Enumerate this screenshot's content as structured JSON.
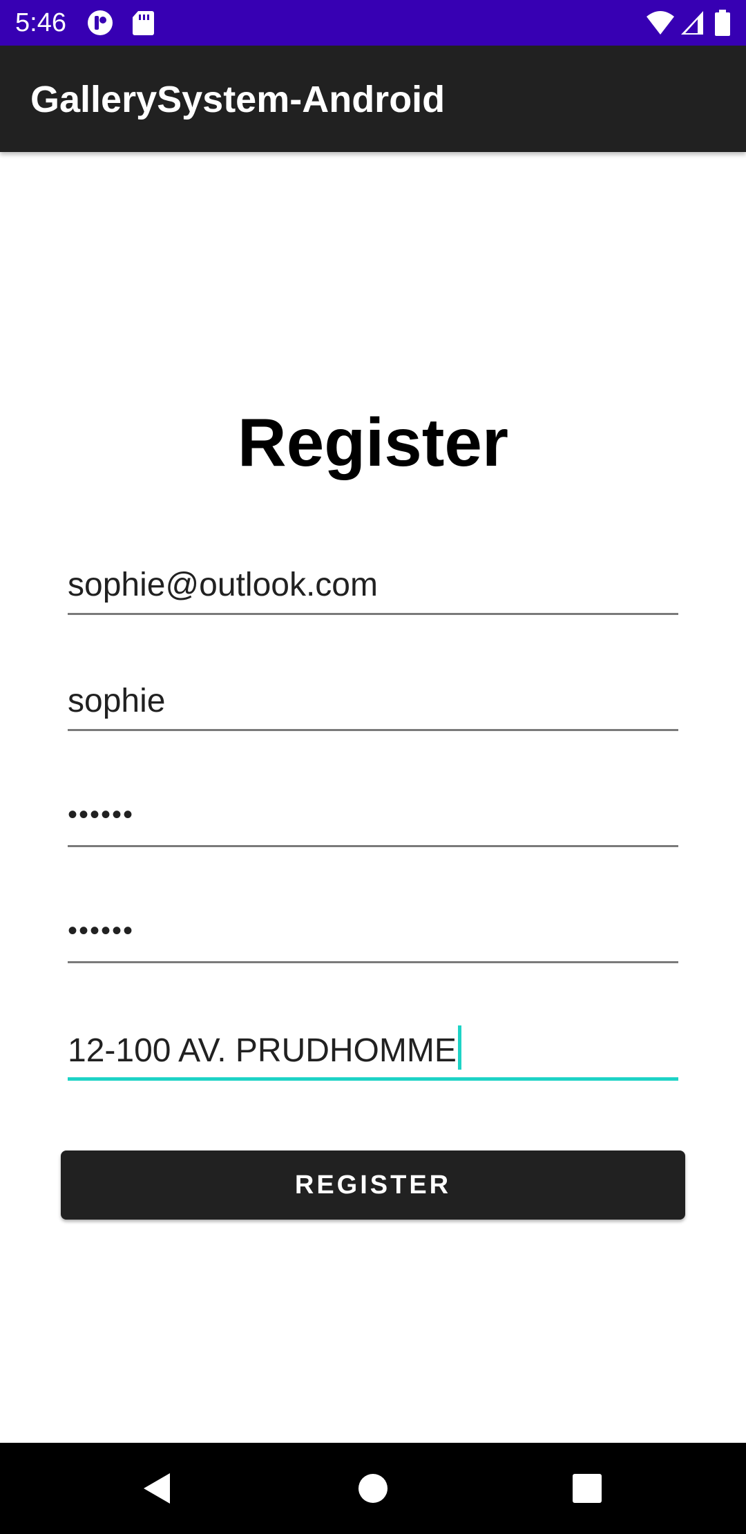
{
  "status_bar": {
    "time": "5:46",
    "left_icons": [
      "app-notification-icon",
      "sd-card-icon"
    ],
    "right_icons": [
      "wifi-icon",
      "cell-signal-icon",
      "battery-icon"
    ],
    "background": "#3700b3"
  },
  "app_bar": {
    "title": "GallerySystem-Android",
    "background": "#212121"
  },
  "form": {
    "heading": "Register",
    "email_value": "sophie@outlook.com",
    "username_value": "sophie",
    "password_value": "••••••",
    "confirm_password_value": "••••••",
    "address_value": "12-100 AV. PRUDHOMME",
    "focus_color": "#1ed3c6",
    "register_button_label": "REGISTER"
  },
  "nav_bar": {
    "icons": [
      "back-icon",
      "home-icon",
      "recents-icon"
    ]
  }
}
